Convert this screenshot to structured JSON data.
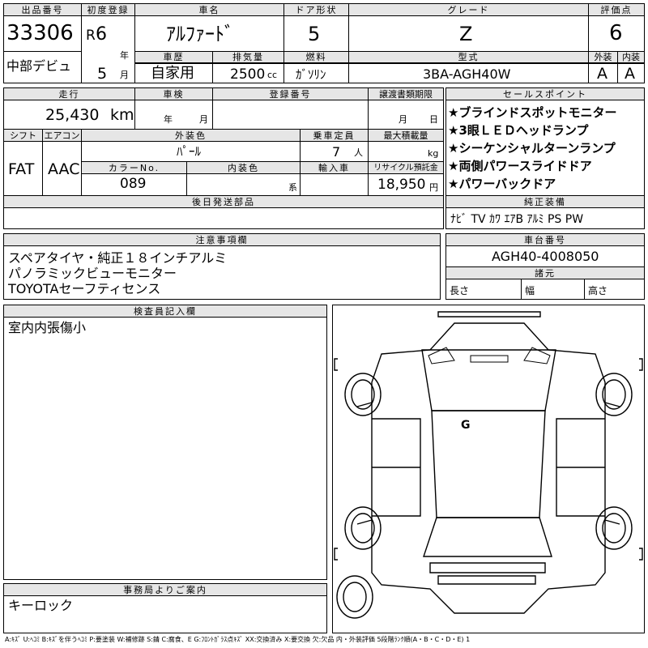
{
  "header": {
    "lot_label": "出品番号",
    "lot_value": "33306",
    "seller": "中部デビュ",
    "first_reg_label": "初度登録",
    "era": "R",
    "year": "6",
    "year_unit": "年",
    "month": "5",
    "month_unit": "月",
    "name_label": "車名",
    "name_value": "ｱﾙﾌｧｰﾄﾞ",
    "door_label": "ドア形状",
    "door_value": "5",
    "grade_label": "グレード",
    "grade_value": "Z",
    "score_label": "評価点",
    "score_value": "6",
    "history_label": "車歴",
    "history_value": "自家用",
    "displacement_label": "排気量",
    "displacement_value": "2500",
    "displacement_unit": "cc",
    "fuel_label": "燃料",
    "fuel_value": "ｶﾞｿﾘﾝ",
    "model_label": "型式",
    "model_value": "3BA-AGH40W",
    "ext_label": "外装",
    "ext_value": "A",
    "int_label": "内装",
    "int_value": "A"
  },
  "row2": {
    "mileage_label": "走行",
    "mileage_value": "25,430",
    "mileage_unit": "km",
    "inspection_label": "車検",
    "insp_year_unit": "年",
    "insp_month_unit": "月",
    "reg_label": "登録番号",
    "transfer_label": "譲渡書類期限",
    "transfer_month_unit": "月",
    "transfer_day_unit": "日",
    "shift_label": "シフト",
    "shift_value": "FAT",
    "ac_label": "エアコン",
    "ac_value": "AAC",
    "exterior_label": "外装色",
    "exterior_value": "ﾊﾟｰﾙ",
    "seats_label": "乗車定員",
    "seats_value": "7",
    "seats_unit": "人",
    "load_label": "最大積載量",
    "load_unit": "kg",
    "colorno_label": "カラーNo.",
    "colorno_value": "089",
    "interior_label": "内装色",
    "interior_unit": "系",
    "import_label": "輸入車",
    "recycle_label": "リサイクル預託金",
    "recycle_value": "18,950",
    "recycle_unit": "円",
    "later_label": "後日発送部品"
  },
  "sales": {
    "label": "セールスポイント",
    "points": [
      "★ブラインドスポットモニター",
      "★3眼ＬＥＤヘッドランプ",
      "★シーケンシャルターンランプ",
      "★両側パワースライドドア",
      "★パワーバックドア"
    ]
  },
  "equipment": {
    "label": "純正装備",
    "value": "ﾅﾋﾞ TV ｶﾜ ｴｱB ｱﾙﾐ PS PW"
  },
  "notes": {
    "label": "注意事項欄",
    "lines": [
      "スペアタイヤ・純正１８インチアルミ",
      "パノラミックビューモニター",
      "TOYOTAセーフティセンス"
    ]
  },
  "chassis": {
    "label": "車台番号",
    "value": "AGH40-4008050",
    "dims_label": "諸元",
    "length": "長さ",
    "width": "幅",
    "height": "高さ"
  },
  "inspector": {
    "label": "検査員記入欄",
    "text": "室内内張傷小"
  },
  "office": {
    "label": "事務局よりご案内",
    "text": "キーロック"
  },
  "diagram": {
    "mark": "G"
  },
  "legend": "A:ｷｽﾞ U:ﾍｺﾐ B:ｷｽﾞを伴うﾍｺﾐ P:要塗装 W:補修跡 S:錆 C:腐食、E G:ﾌﾛﾝﾄｶﾞﾗｽ点ｷｽﾞ XX:交換済み X:要交換 欠:欠品 内・外装評価 5段階ﾗﾝｸ順(A・B・C・D・E) 1"
}
